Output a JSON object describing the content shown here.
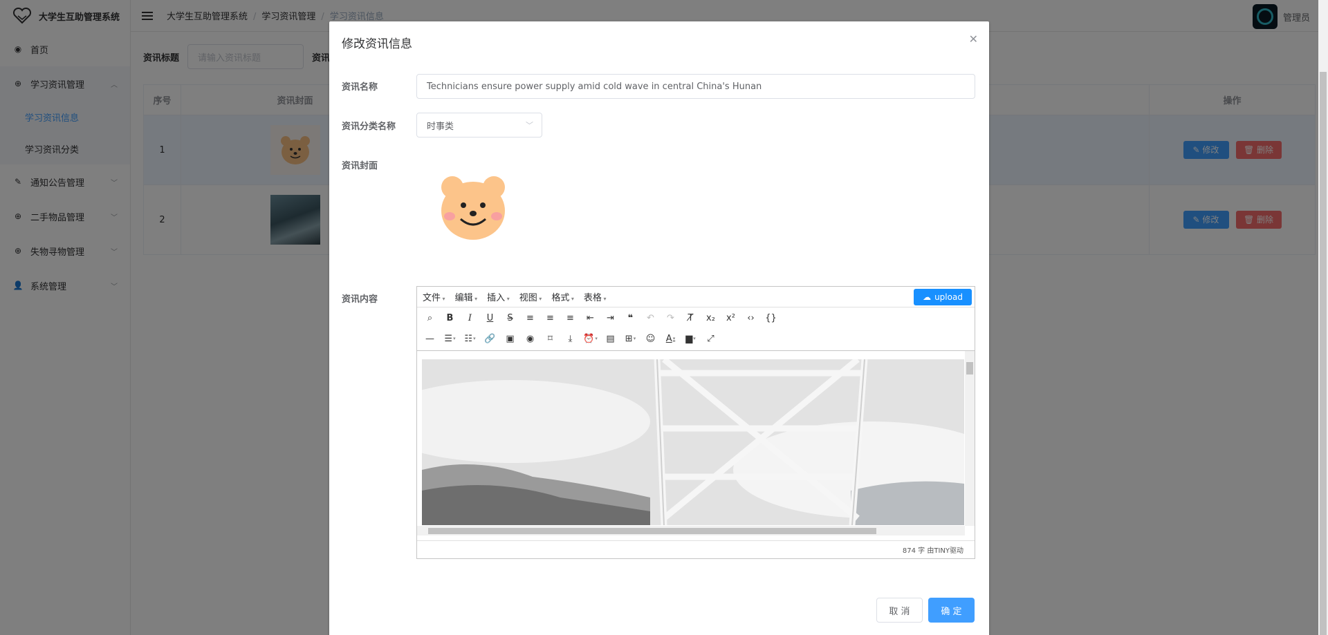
{
  "app": {
    "title": "大学生互助管理系统",
    "user": "管理员"
  },
  "sidebar": {
    "items": [
      {
        "label": "首页",
        "icon": "dashboard-icon"
      },
      {
        "label": "学习资讯管理",
        "icon": "plus-circle-icon",
        "children": [
          "学习资讯信息",
          "学习资讯分类"
        ]
      },
      {
        "label": "通知公告管理",
        "icon": "edit-icon"
      },
      {
        "label": "二手物品管理",
        "icon": "plus-circle-icon"
      },
      {
        "label": "失物寻物管理",
        "icon": "plus-circle-icon"
      },
      {
        "label": "系统管理",
        "icon": "user-icon"
      }
    ]
  },
  "breadcrumb": [
    "大学生互助管理系统",
    "学习资讯管理",
    "学习资讯信息"
  ],
  "search": {
    "label1": "资讯标题",
    "placeholder1": "请输入资讯标题",
    "label2": "资讯分"
  },
  "table": {
    "headers": [
      "序号",
      "资讯封面",
      "操作"
    ],
    "rows": [
      {
        "index": "1"
      },
      {
        "index": "2"
      }
    ],
    "edit_label": "修改",
    "delete_label": "删除"
  },
  "dialog": {
    "title": "修改资讯信息",
    "name_label": "资讯名称",
    "name_value": "Technicians ensure power supply amid cold wave in central China's Hunan",
    "category_label": "资讯分类名称",
    "category_value": "时事类",
    "cover_label": "资讯封面",
    "content_label": "资讯内容",
    "editor": {
      "menus": [
        "文件",
        "编辑",
        "插入",
        "视图",
        "格式",
        "表格"
      ],
      "upload_label": "upload",
      "status": "874 字 由TINY驱动"
    },
    "cancel_label": "取 消",
    "confirm_label": "确 定"
  },
  "colors": {
    "primary": "#409eff",
    "danger": "#f56c6c",
    "upload": "#1890ff"
  }
}
